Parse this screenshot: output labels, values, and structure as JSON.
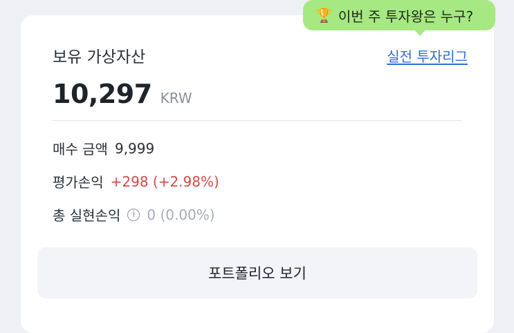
{
  "tooltip": {
    "icon": "trophy-icon",
    "text": "이번 주 투자왕은 누구?"
  },
  "header": {
    "title": "보유 가상자산",
    "link": "실전 투자리그"
  },
  "balance": {
    "amount": "10,297",
    "unit": "KRW"
  },
  "details": {
    "buy_label": "매수 금액",
    "buy_value": "9,999",
    "eval_label": "평가손익",
    "eval_value": "+298 (+2.98%)",
    "realized_label": "총 실현손익",
    "realized_value": "0 (0.00%)"
  },
  "button": {
    "label": "포트폴리오 보기"
  },
  "colors": {
    "accent_link": "#2f6bd8",
    "profit": "#d24a4a",
    "tooltip_bg": "#a6e882"
  }
}
